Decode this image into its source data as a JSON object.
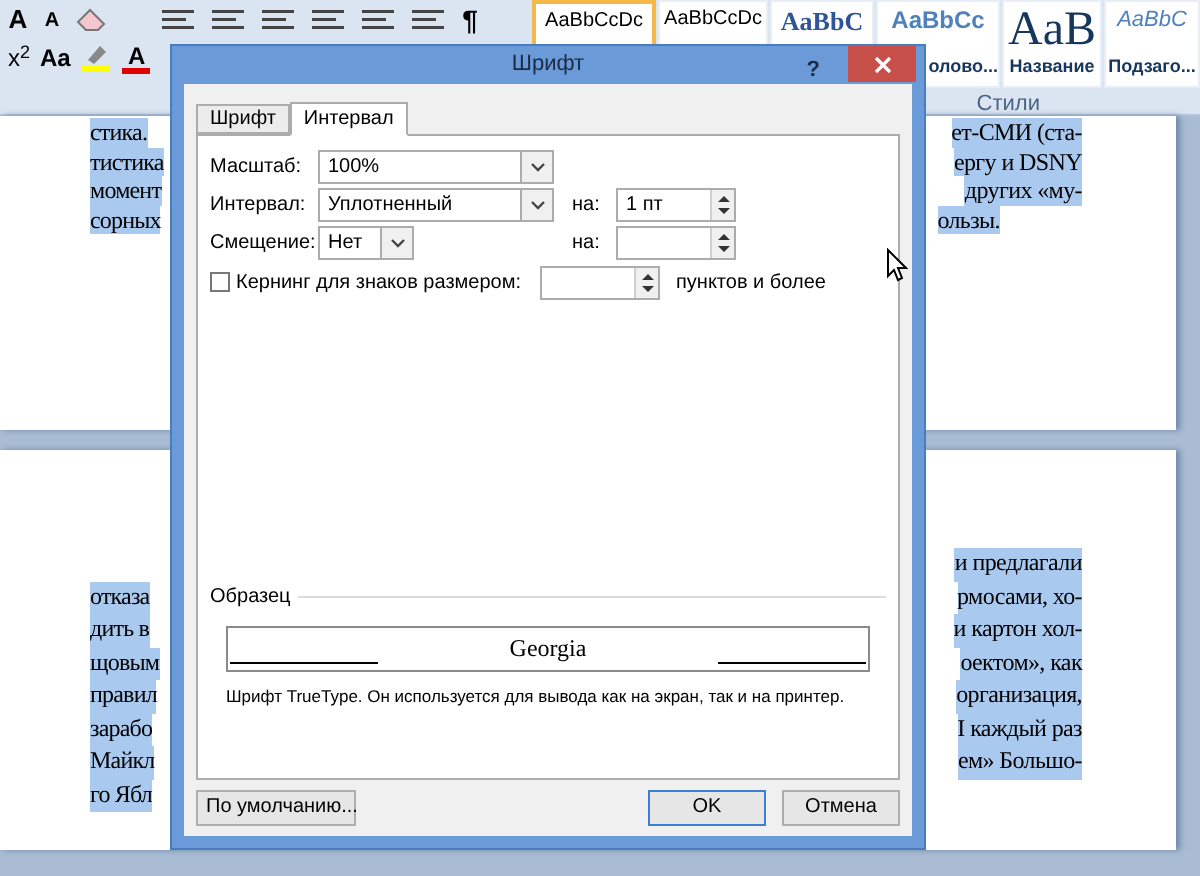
{
  "ribbon": {
    "font_buttons": [
      "A",
      "A"
    ],
    "case_button": "Aa",
    "font_color_button": "A",
    "pilcrow_button": "¶",
    "superscript_button": "x$^{2}$",
    "styles": [
      {
        "preview": "AaBbCcDc",
        "kind": "normal",
        "selected": true
      },
      {
        "preview": "AaBbCcDc",
        "kind": "plain",
        "selected": false
      },
      {
        "preview": "AaBbC",
        "kind": "heading1",
        "selected": false
      },
      {
        "preview": "AaBbCc",
        "kind": "heading2",
        "label": "олово...",
        "selected": false
      },
      {
        "preview": "AaB",
        "kind": "title",
        "label": "Название",
        "selected": false
      },
      {
        "preview": "AaBbC",
        "kind": "subtitle",
        "label": "Подзаго...",
        "selected": false
      }
    ],
    "group_label": "Стили"
  },
  "pages": [
    {
      "lines": [
        {
          "left": "стика.",
          "right": "ет-СМИ (ста-"
        },
        {
          "left": "тистика",
          "right": "ергу и DSNY"
        },
        {
          "left": "момент",
          "right": "других «му-"
        },
        {
          "left": "сорных",
          "right": "ользы.",
          "paragraph_end": true
        }
      ]
    },
    {
      "lines": [
        {
          "right": "и предлагали"
        },
        {
          "left": "отказа",
          "right": "рмосами, хо-"
        },
        {
          "left": "дить в",
          "right": "и картон хол-"
        },
        {
          "left": "щовым",
          "right": "оектом», как"
        },
        {
          "left": "правил",
          "right": "организация,"
        },
        {
          "left": "зарабо",
          "right": "I каждый раз"
        },
        {
          "left": "Майкл",
          "right": "ем» Большо-"
        },
        {
          "left": "го Ябл"
        }
      ]
    }
  ],
  "dialog": {
    "title": "Шрифт",
    "help": "?",
    "tabs": [
      {
        "label": "Шрифт",
        "selected": false
      },
      {
        "label": "Интервал",
        "selected": true
      }
    ],
    "scale": {
      "label": "Масштаб:",
      "value": "100%"
    },
    "spacing": {
      "label": "Интервал:",
      "value": "Уплотненный",
      "by_label": "на:",
      "by_value": "1 пт"
    },
    "position": {
      "label": "Смещение:",
      "value": "Нет",
      "by_label": "на:"
    },
    "kerning": {
      "label": "Кернинг для знаков размером:",
      "checked": false,
      "suffix": "пунктов и более"
    },
    "preview": {
      "label": "Образец",
      "sample": "Georgia",
      "note": "Шрифт TrueType. Он используется для вывода как на экран, так и на принтер."
    },
    "buttons": [
      {
        "label": "По умолчанию...",
        "kind": "default",
        "focused": false
      },
      {
        "label": "OK",
        "kind": "ok",
        "focused": true
      },
      {
        "label": "Отмена",
        "kind": "cancel",
        "focused": false
      }
    ]
  }
}
